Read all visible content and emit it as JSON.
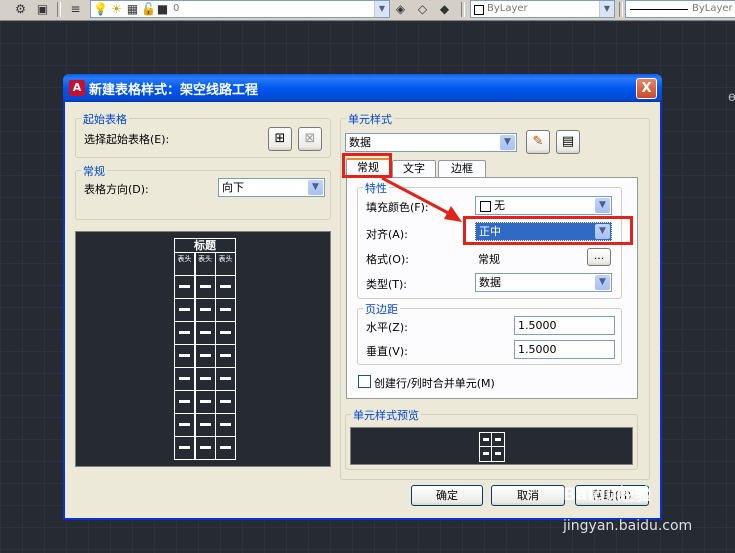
{
  "toolbar": {
    "layer_value": "0",
    "color_value": "ByLayer",
    "linetype_value": "ByLayer"
  },
  "canvas": {
    "side_text": "ө"
  },
  "dialog": {
    "title": "新建表格样式：架空线路工程",
    "close_label": "X",
    "start_table": {
      "group_title": "起始表格",
      "select_label": "选择起始表格(E):"
    },
    "general": {
      "group_title": "常规",
      "direction_label": "表格方向(D):",
      "direction_value": "向下"
    },
    "table_preview": {
      "title": "标题",
      "header_cell": "表头",
      "data_rows": 8,
      "columns": 3
    },
    "cell_style": {
      "group_title": "单元样式",
      "style_value": "数据",
      "tabs": [
        {
          "label": "常规",
          "active": true
        },
        {
          "label": "文字",
          "active": false
        },
        {
          "label": "边框",
          "active": false
        }
      ],
      "properties": {
        "group_title": "特性",
        "fill_color_label": "填充颜色(F):",
        "fill_color_value": "无",
        "alignment_label": "对齐(A):",
        "alignment_value": "正中",
        "format_label": "格式(O):",
        "format_value": "常规",
        "format_button": "...",
        "type_label": "类型(T):",
        "type_value": "数据"
      },
      "margins": {
        "group_title": "页边距",
        "horizontal_label": "水平(Z):",
        "horizontal_value": "1.5000",
        "vertical_label": "垂直(V):",
        "vertical_value": "1.5000"
      },
      "merge_checkbox_label": "创建行/列时合并单元(M)",
      "merge_checked": false
    },
    "cell_preview": {
      "group_title": "单元样式预览"
    },
    "buttons": {
      "ok": "确定",
      "cancel": "取消",
      "help": "帮助(H)"
    }
  },
  "watermark": {
    "brand": "Baidu经验",
    "url": "jingyan.baidu.com"
  },
  "colors": {
    "highlight_red": "#e2231a",
    "selection_blue": "#316ac5",
    "group_title_blue": "#0046d5",
    "titlebar_blue": "#0058ee",
    "canvas_bg": "#252a33"
  }
}
